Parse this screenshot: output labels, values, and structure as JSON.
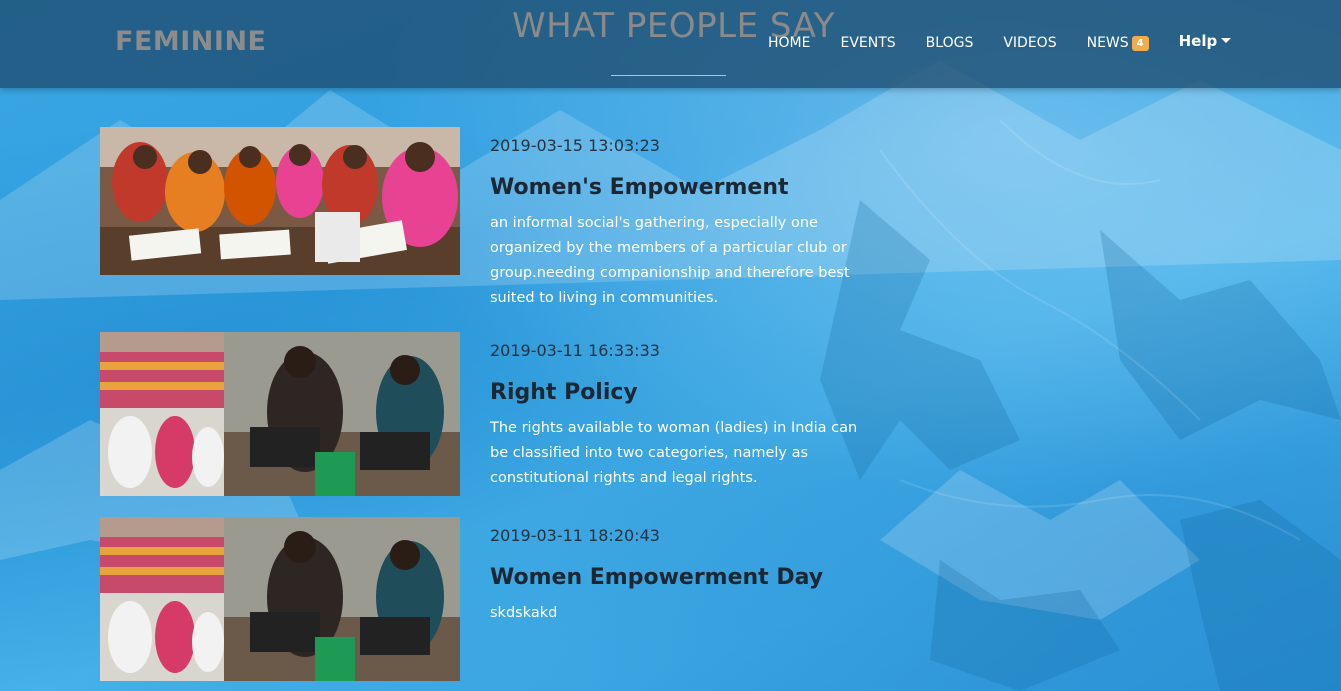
{
  "header": {
    "brand": "FEMININE",
    "section_title": "WHAT PEOPLE SAY",
    "nav": [
      {
        "label": "HOME"
      },
      {
        "label": "EVENTS"
      },
      {
        "label": "BLOGS"
      },
      {
        "label": "VIDEOS"
      },
      {
        "label": "NEWS",
        "badge": "4"
      }
    ],
    "help_label": "Help"
  },
  "posts": [
    {
      "date": "2019-03-15 13:03:23",
      "title": "Women's Empowerment",
      "description": "an informal social's gathering, especially one organized by the members of a particular club or group.needing companionship and therefore best suited to living in communities.",
      "image_alt": "women-writing-in-classroom-photo"
    },
    {
      "date": "2019-03-11 16:33:33",
      "title": "Right Policy",
      "description": "The rights available to woman (ladies) in India can be classified into two categories, namely as constitutional rights and legal rights.",
      "image_alt": "women-sewing-machines-collage-photo"
    },
    {
      "date": "2019-03-11 18:20:43",
      "title": "Women Empowerment Day",
      "description": "skdskakd",
      "image_alt": "women-sewing-machines-collage-photo"
    }
  ],
  "colors": {
    "header_bg": "#1e4b6e",
    "page_bg": "#3aa7e2",
    "badge": "#f0ad4e",
    "title_text": "#1b2733"
  }
}
